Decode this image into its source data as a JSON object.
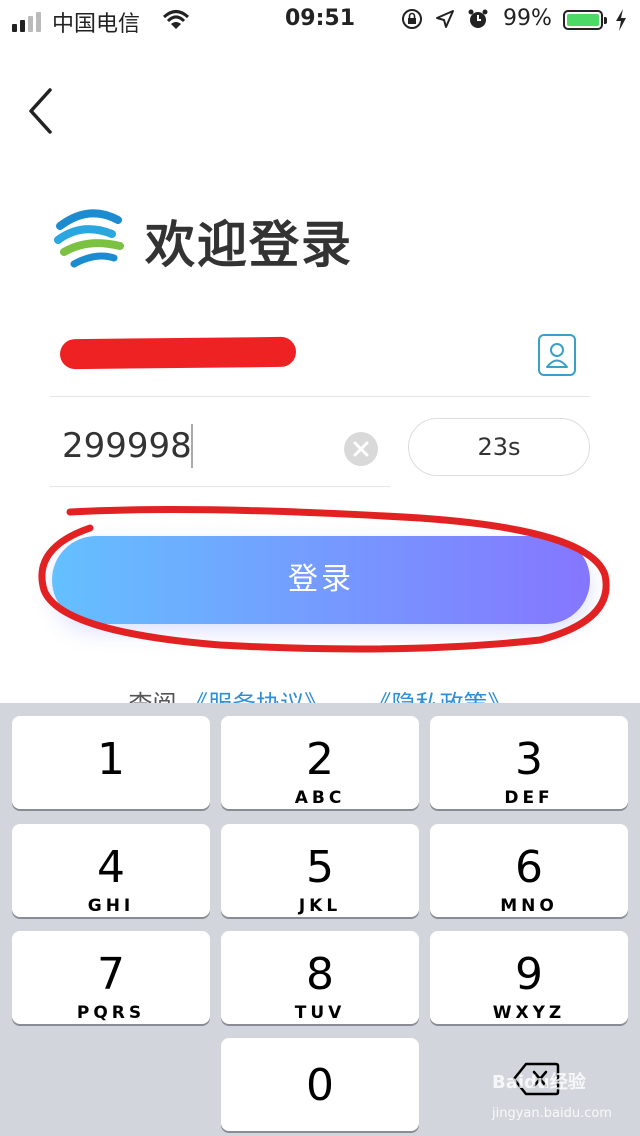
{
  "status": {
    "carrier": "中国电信",
    "time": "09:51",
    "battery_pct": "99%",
    "icons": [
      "signal-icon",
      "wifi-icon",
      "rotation-lock-icon",
      "location-icon",
      "alarm-icon",
      "battery-icon",
      "charging-icon"
    ]
  },
  "header": {
    "back_icon": "chevron-left-icon",
    "logo_icon": "china-mobile-logo",
    "title": "欢迎登录"
  },
  "form": {
    "phone_value": "",
    "contact_icon": "contact-person-icon",
    "code_value": "299998",
    "clear_icon": "clear-x-icon",
    "countdown": "23s",
    "login_label": "登录"
  },
  "agreement": {
    "prefix": "查阅",
    "service": "《服务协议》",
    "and": "、",
    "privacy": "《隐私政策》"
  },
  "keyboard": {
    "keys": [
      {
        "num": "1",
        "letters": ""
      },
      {
        "num": "2",
        "letters": "ABC"
      },
      {
        "num": "3",
        "letters": "DEF"
      },
      {
        "num": "4",
        "letters": "GHI"
      },
      {
        "num": "5",
        "letters": "JKL"
      },
      {
        "num": "6",
        "letters": "MNO"
      },
      {
        "num": "7",
        "letters": "PQRS"
      },
      {
        "num": "8",
        "letters": "TUV"
      },
      {
        "num": "9",
        "letters": "WXYZ"
      },
      {
        "num": "0",
        "letters": ""
      }
    ],
    "delete_icon": "backspace-icon"
  },
  "watermark": {
    "brand": "Baidu经验",
    "url": "jingyan.baidu.com"
  },
  "colors": {
    "accent_start": "#64c0ff",
    "accent_end": "#8576ff",
    "link": "#2e8fd8",
    "annotation": "#e22222"
  }
}
